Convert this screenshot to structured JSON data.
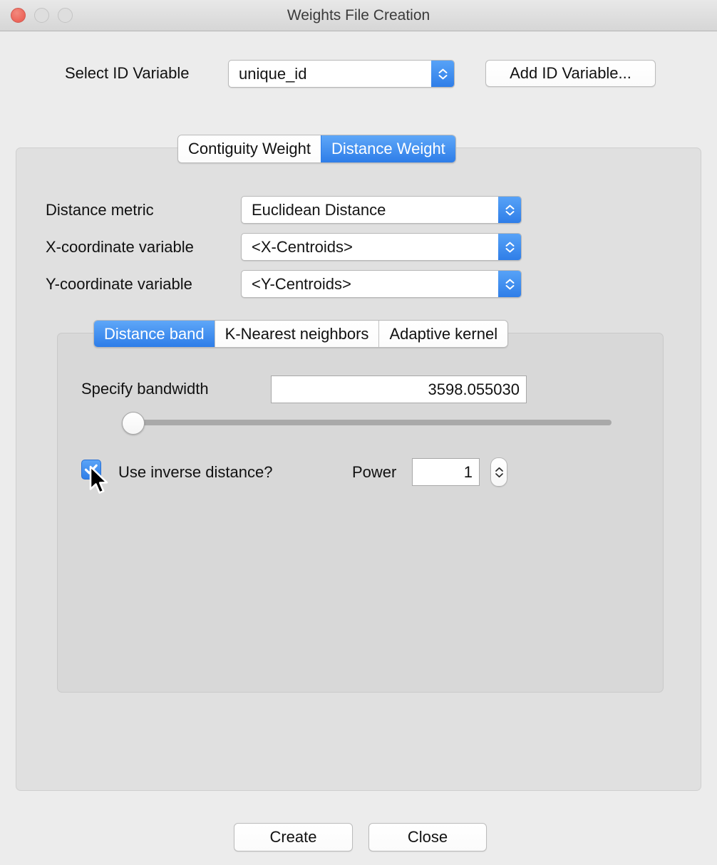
{
  "window": {
    "title": "Weights File Creation",
    "controls": {
      "close": "close-button",
      "minimize": "minimize-button",
      "maximize": "maximize-button"
    }
  },
  "id_row": {
    "label": "Select ID Variable",
    "combo_value": "unique_id",
    "add_button": "Add ID Variable..."
  },
  "outer_tabs": [
    {
      "label": "Contiguity Weight",
      "selected": false
    },
    {
      "label": "Distance Weight",
      "selected": true
    }
  ],
  "distance_weight": {
    "metric": {
      "label": "Distance metric",
      "value": "Euclidean Distance"
    },
    "x_coord": {
      "label": "X-coordinate variable",
      "value": "<X-Centroids>"
    },
    "y_coord": {
      "label": "Y-coordinate variable",
      "value": "<Y-Centroids>"
    }
  },
  "inner_tabs": [
    {
      "label": "Distance band",
      "selected": true
    },
    {
      "label": "K-Nearest neighbors",
      "selected": false
    },
    {
      "label": "Adaptive kernel",
      "selected": false
    }
  ],
  "distance_band": {
    "bandwidth_label": "Specify bandwidth",
    "bandwidth_value": "3598.055030",
    "slider_position_percent": 0,
    "inverse_label": "Use inverse distance?",
    "inverse_checked": true,
    "power_label": "Power",
    "power_value": "1"
  },
  "footer": {
    "create": "Create",
    "close": "Close"
  },
  "colors": {
    "accent_blue": "#2f7ee8",
    "window_bg": "#ececec",
    "panel_bg": "#e0e0e0",
    "inner_panel_bg": "#d8d8d8",
    "close_red": "#ee6a5f"
  }
}
